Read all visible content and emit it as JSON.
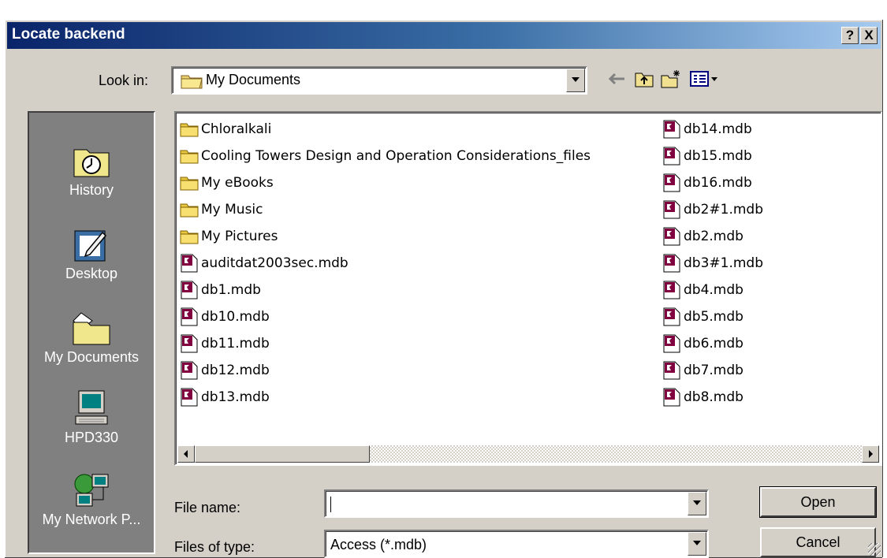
{
  "window": {
    "title": "Locate backend",
    "help_label": "?",
    "close_label": "X"
  },
  "look_in": {
    "label": "Look in:",
    "value": "My Documents"
  },
  "toolbar": {
    "icons": [
      "back-arrow-icon",
      "up-folder-icon",
      "new-folder-icon",
      "view-menu-icon"
    ]
  },
  "places": [
    {
      "label": "History",
      "icon": "history-clock-icon"
    },
    {
      "label": "Desktop",
      "icon": "desktop-icon"
    },
    {
      "label": "My Documents",
      "icon": "my-documents-folder-icon"
    },
    {
      "label": "HPD330",
      "icon": "computer-icon"
    },
    {
      "label": "My Network P...",
      "icon": "network-places-icon"
    }
  ],
  "files_col1": [
    {
      "name": "Chloralkali",
      "type": "folder"
    },
    {
      "name": "Cooling Towers Design and Operation Considerations_files",
      "type": "folder"
    },
    {
      "name": "My eBooks",
      "type": "folder"
    },
    {
      "name": "My Music",
      "type": "folder"
    },
    {
      "name": "My Pictures",
      "type": "folder"
    },
    {
      "name": "auditdat2003sec.mdb",
      "type": "mdb"
    },
    {
      "name": "db1.mdb",
      "type": "mdb"
    },
    {
      "name": "db10.mdb",
      "type": "mdb"
    },
    {
      "name": "db11.mdb",
      "type": "mdb"
    },
    {
      "name": "db12.mdb",
      "type": "mdb"
    },
    {
      "name": "db13.mdb",
      "type": "mdb"
    }
  ],
  "files_col2": [
    {
      "name": "db14.mdb",
      "type": "mdb"
    },
    {
      "name": "db15.mdb",
      "type": "mdb"
    },
    {
      "name": "db16.mdb",
      "type": "mdb"
    },
    {
      "name": "db2#1.mdb",
      "type": "mdb"
    },
    {
      "name": "db2.mdb",
      "type": "mdb"
    },
    {
      "name": "db3#1.mdb",
      "type": "mdb"
    },
    {
      "name": "db4.mdb",
      "type": "mdb"
    },
    {
      "name": "db5.mdb",
      "type": "mdb"
    },
    {
      "name": "db6.mdb",
      "type": "mdb"
    },
    {
      "name": "db7.mdb",
      "type": "mdb"
    },
    {
      "name": "db8.mdb",
      "type": "mdb"
    }
  ],
  "file_name": {
    "label": "File name:",
    "value": ""
  },
  "file_type": {
    "label": "Files of type:",
    "value": "Access (*.mdb)"
  },
  "buttons": {
    "open": "Open",
    "cancel": "Cancel"
  }
}
